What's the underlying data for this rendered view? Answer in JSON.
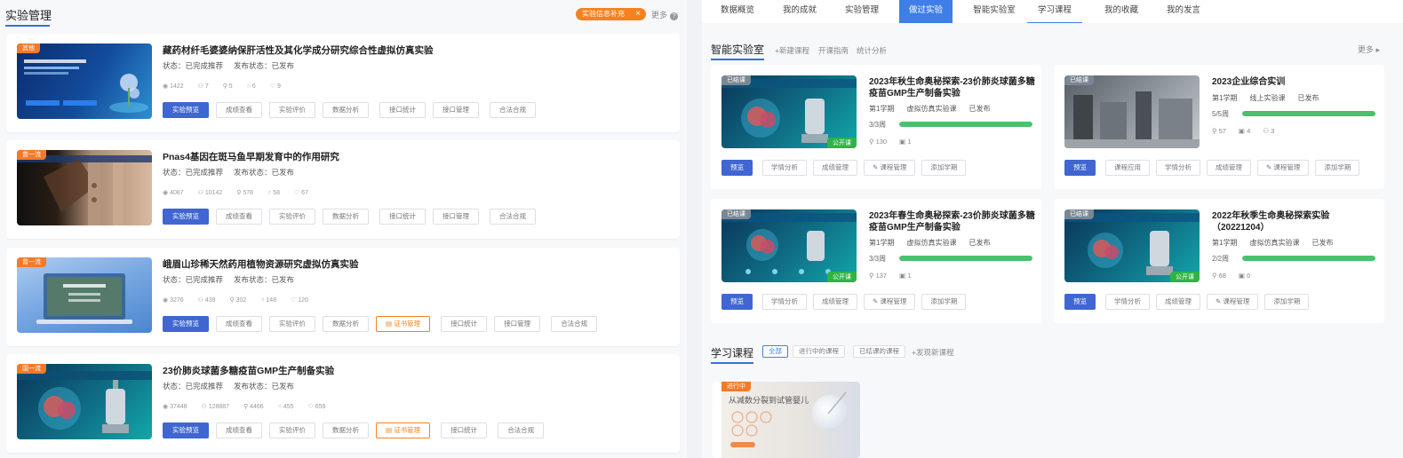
{
  "left": {
    "title": "实验管理",
    "notice": "实验信息补充",
    "notice_close": "×",
    "more": "更多",
    "more_icon": "?",
    "experiments": [
      {
        "tag": "其他",
        "title": "藏药材纤毛婆婆纳保肝活性及其化学成分研究综合性虚拟仿真实验",
        "status": "状态：已完成推荐",
        "publish": "发布状态：已发布",
        "stats": [
          "1422",
          "7",
          "5",
          "6",
          "9"
        ],
        "buttons": [
          "实验预览",
          "成绩查看",
          "实验评价",
          "数据分析",
          "接口统计",
          "接口管理",
          "合法合规"
        ],
        "cert": ""
      },
      {
        "tag": "曾一流",
        "title": "Pnas4基因在斑马鱼早期发育中的作用研究",
        "status": "状态：已完成推荐",
        "publish": "发布状态：已发布",
        "stats": [
          "4087",
          "10142",
          "578",
          "58",
          "67"
        ],
        "buttons": [
          "实验预览",
          "成绩查看",
          "实验评价",
          "数据分析",
          "接口统计",
          "接口管理",
          "合法合规"
        ],
        "cert": ""
      },
      {
        "tag": "曾一流",
        "title": "峨眉山珍稀天然药用植物资源研究虚拟仿真实验",
        "status": "状态：已完成推荐",
        "publish": "发布状态：已发布",
        "stats": [
          "3276",
          "439",
          "302",
          "148",
          "120"
        ],
        "buttons": [
          "实验预览",
          "成绩查看",
          "实验评价",
          "数据分析",
          "证书管理",
          "接口统计",
          "接口管理",
          "合法合规"
        ],
        "cert": "证书管理"
      },
      {
        "tag": "国一流",
        "title": "23价肺炎球菌多糖疫苗GMP生产制备实验",
        "status": "状态：已完成推荐",
        "publish": "发布状态：已发布",
        "stats": [
          "37448",
          "128887",
          "4466",
          "455",
          "659"
        ],
        "buttons": [
          "实验预览",
          "成绩查看",
          "实验评价",
          "数据分析",
          "证书管理",
          "接口统计",
          "合法合规"
        ],
        "cert": "证书管理"
      }
    ]
  },
  "right": {
    "nav": [
      "数据概览",
      "我的成就",
      "实验管理",
      "做过实验",
      "智能实验室",
      "学习课程",
      "我的收藏",
      "我的发言"
    ],
    "lab": {
      "title": "智能实验室",
      "links": [
        "+新建课程",
        "开课指南",
        "统计分析"
      ],
      "more": "更多",
      "courses": [
        {
          "tag": "已结课",
          "title": "2023年秋生命奥秘探索-23价肺炎球菌多糖疫苗GMP生产制备实验",
          "meta": [
            "第1学期",
            "虚拟仿真实验课",
            "已发布"
          ],
          "progress": "3/3周",
          "fill": 1.0,
          "stats": [
            "130",
            "1"
          ],
          "open": "公开课",
          "buttons": [
            "预览",
            "学情分析",
            "成绩管理",
            "课程管理",
            "添加学期"
          ]
        },
        {
          "tag": "已结课",
          "title": "2023企业综合实训",
          "meta": [
            "第1学期",
            "线上实验课",
            "已发布"
          ],
          "progress": "5/5周",
          "fill": 1.0,
          "stats": [
            "57",
            "4",
            "3"
          ],
          "open": "",
          "buttons": [
            "预览",
            "课程应用",
            "学情分析",
            "成绩管理",
            "课程管理",
            "添加学期"
          ]
        },
        {
          "tag": "已结课",
          "title": "2023年春生命奥秘探索-23价肺炎球菌多糖疫苗GMP生产制备实验",
          "meta": [
            "第1学期",
            "虚拟仿真实验课",
            "已发布"
          ],
          "progress": "3/3周",
          "fill": 1.0,
          "stats": [
            "137",
            "1"
          ],
          "open": "公开课",
          "buttons": [
            "预览",
            "学情分析",
            "成绩管理",
            "课程管理",
            "添加学期"
          ]
        },
        {
          "tag": "已结课",
          "title": "2022年秋季生命奥秘探索实验（20221204）",
          "meta": [
            "第1学期",
            "虚拟仿真实验课",
            "已发布"
          ],
          "progress": "2/2周",
          "fill": 1.0,
          "stats": [
            "68",
            "0"
          ],
          "open": "公开课",
          "buttons": [
            "预览",
            "学情分析",
            "成绩管理",
            "课程管理",
            "添加学期"
          ]
        }
      ]
    },
    "learning": {
      "title": "学习课程",
      "tabs": [
        "全部",
        "进行中的课程",
        "已结课的课程"
      ],
      "discover": "+发现新课程",
      "card_tag": "进行中",
      "card_title": "从减数分裂到试管婴儿"
    }
  }
}
